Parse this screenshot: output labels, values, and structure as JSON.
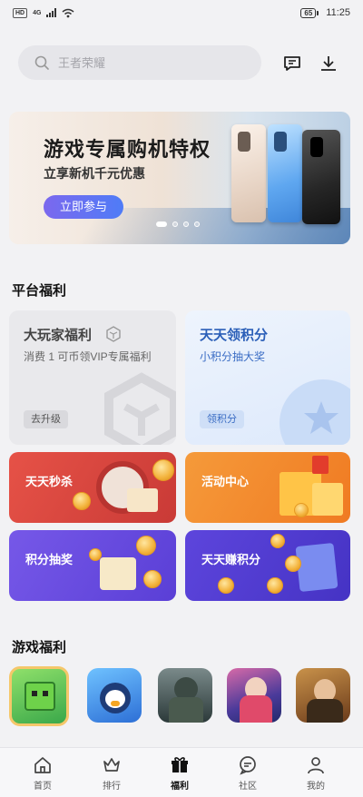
{
  "status_bar": {
    "hd": "HD",
    "network": "4G",
    "battery": "65",
    "time": "11:25"
  },
  "search": {
    "placeholder": "王者荣耀"
  },
  "header_icons": {
    "message": "message-icon",
    "download": "download-icon"
  },
  "banner": {
    "title": "游戏专属购机特权",
    "subtitle": "立享新机千元优惠",
    "button": "立即参与",
    "page_count": 4,
    "active_page": 1
  },
  "platform_benefits": {
    "title": "平台福利",
    "cards": [
      {
        "title": "大玩家福利",
        "subtitle": "消费 1 可币领VIP专属福利",
        "button": "去升级"
      },
      {
        "title": "天天领积分",
        "subtitle": "小积分抽大奖",
        "button": "领积分"
      }
    ],
    "tiles": [
      {
        "label": "天天秒杀"
      },
      {
        "label": "活动中心"
      },
      {
        "label": "积分抽奖"
      },
      {
        "label": "天天赚积分"
      }
    ]
  },
  "game_benefits": {
    "title": "游戏福利",
    "games": [
      "mini-world-icon",
      "penguin-game-icon",
      "shooter-game-icon",
      "moba-game-icon",
      "hero-game-icon"
    ]
  },
  "tabbar": {
    "tabs": [
      {
        "label": "首页",
        "icon": "home-icon"
      },
      {
        "label": "排行",
        "icon": "crown-icon"
      },
      {
        "label": "福利",
        "icon": "gift-icon",
        "active": true
      },
      {
        "label": "社区",
        "icon": "chat-icon"
      },
      {
        "label": "我的",
        "icon": "user-icon"
      }
    ]
  },
  "colors": {
    "accent": "#4f7cf7",
    "active_tab": "#111111",
    "seckill": "#e04a3f",
    "activity": "#f38a2c",
    "lottery": "#6b4be0"
  }
}
